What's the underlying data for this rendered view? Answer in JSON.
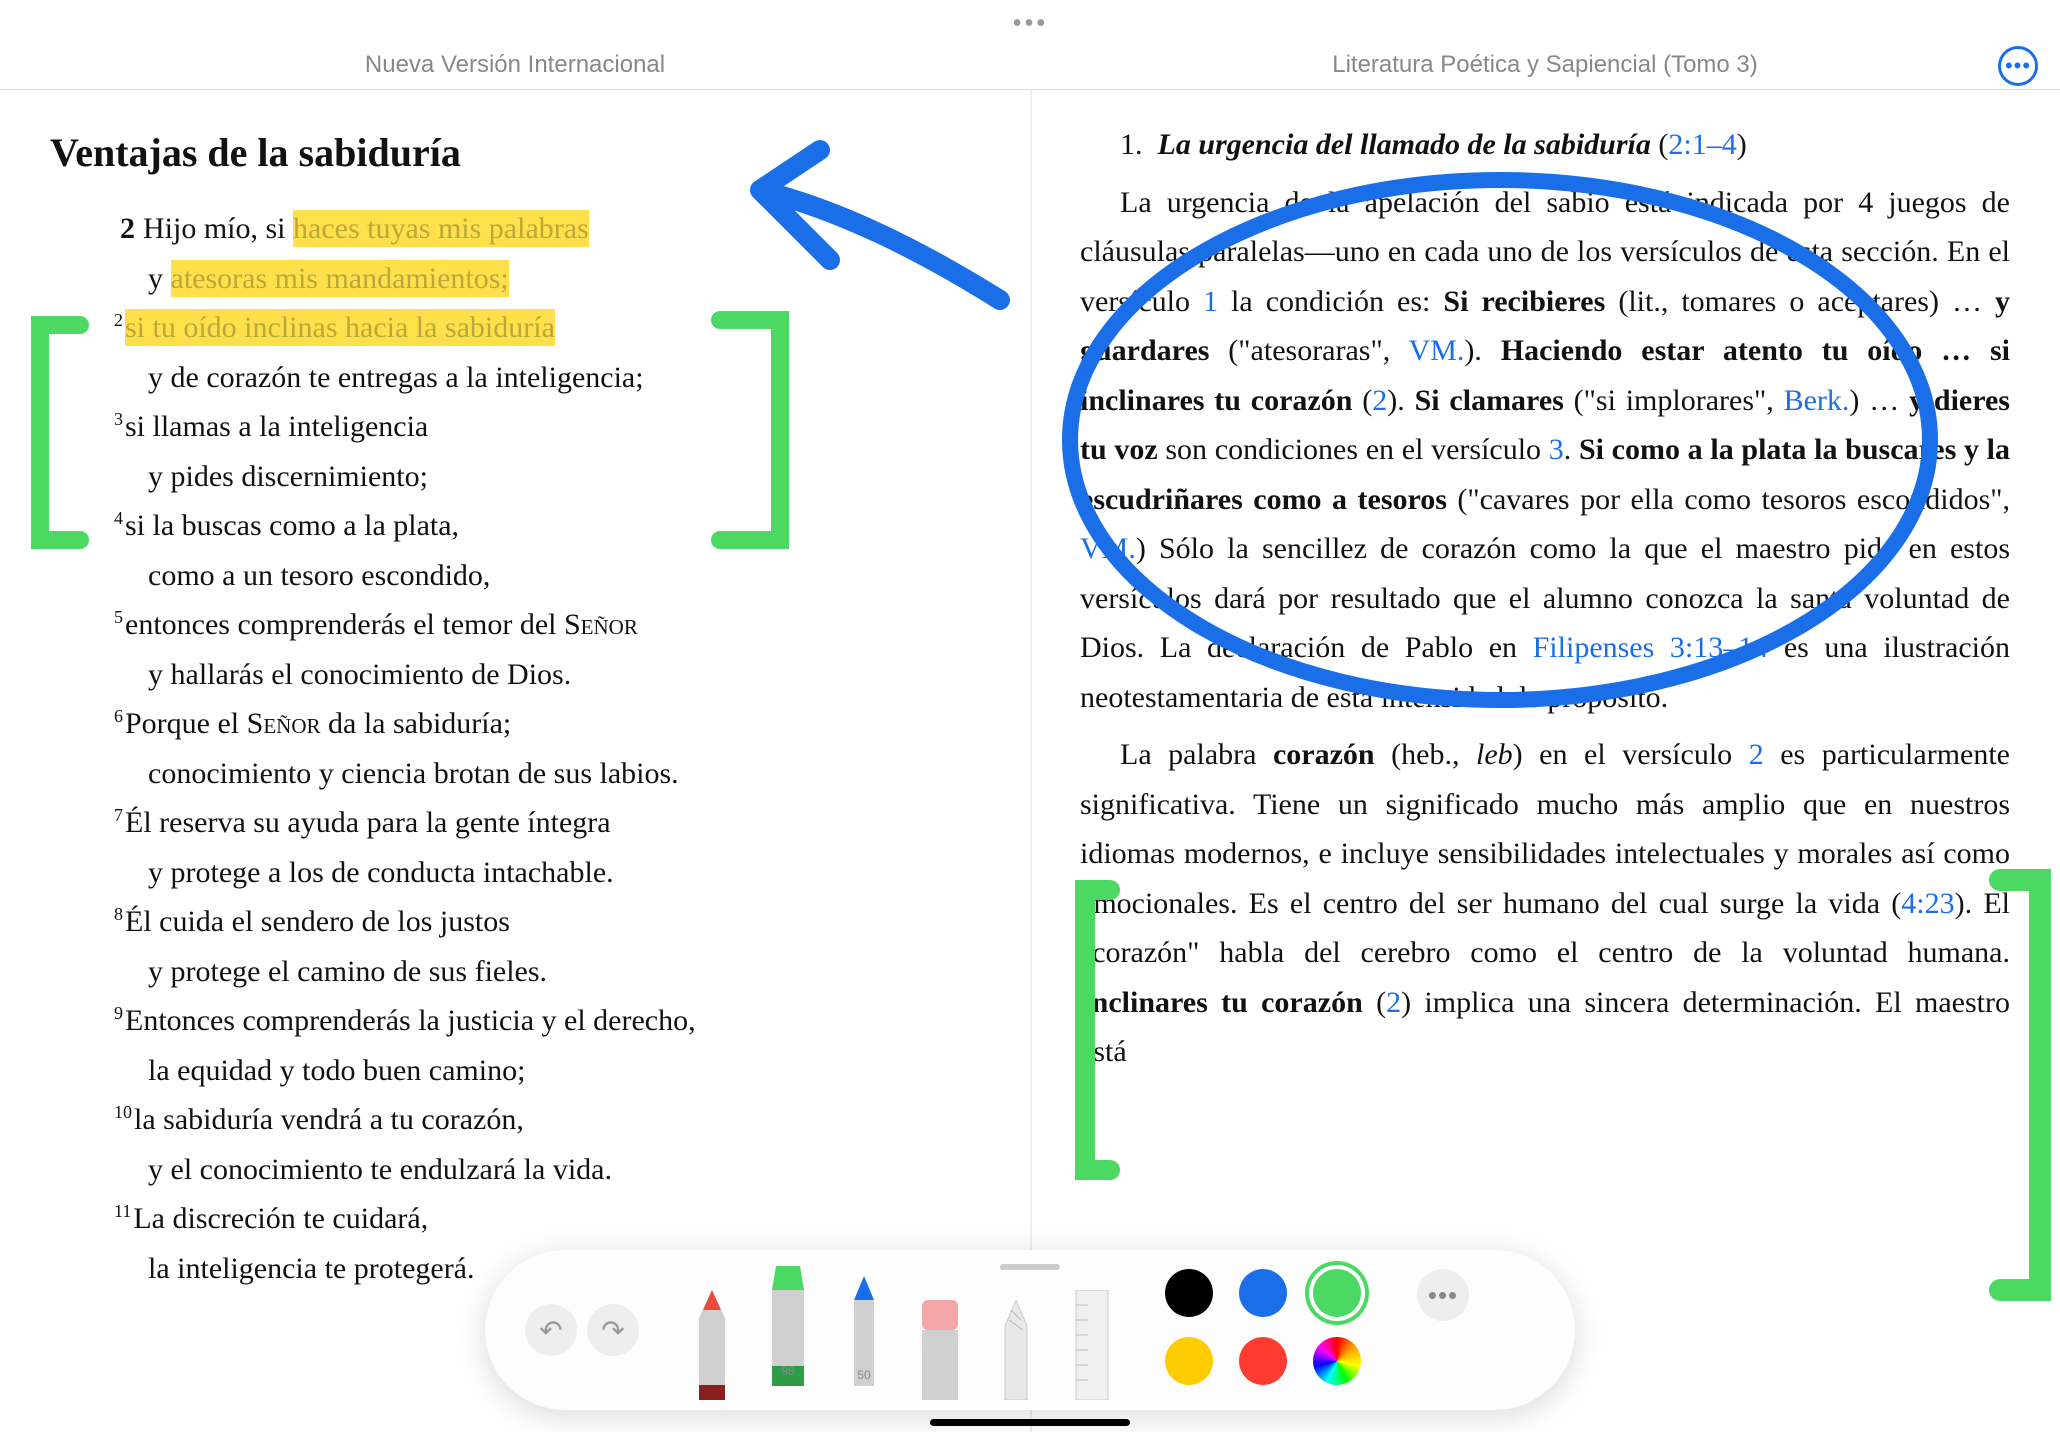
{
  "header": {
    "left_title": "Nueva Versión Internacional",
    "right_title": "Literatura Poética y Sapiencial (Tomo 3)"
  },
  "left": {
    "section_title": "Ventajas de la sabiduría",
    "v2_num": "2",
    "v2a_pre": "Hijo mío, si ",
    "v2a_hl": "haces tuyas mis palabras",
    "v2b_pre": "y ",
    "v2b_hl": "atesoras mis mandamientos;",
    "v2s_num": "2",
    "v2s_hl": "si tu oído inclinas hacia la sabiduría",
    "v2d": "y de corazón te entregas a la inteligencia;",
    "v3_num": "3",
    "v3a": "si llamas a la inteligencia",
    "v3b": "y pides discernimiento;",
    "v4_num": "4",
    "v4a": "si la buscas como a la plata,",
    "v4b": "como a un tesoro escondido,",
    "v5_num": "5",
    "v5a_pre": "entonces comprenderás el temor del ",
    "v5a_sc": "Señor",
    "v5b": "y hallarás el conocimiento de Dios.",
    "v6_num": "6",
    "v6a_pre": "Porque el ",
    "v6a_sc": "Señor",
    "v6a_post": " da la sabiduría;",
    "v6b": "conocimiento y ciencia brotan de sus labios.",
    "v7_num": "7",
    "v7a": "Él reserva su ayuda para la gente íntegra",
    "v7b": "y protege a los de conducta intachable.",
    "v8_num": "8",
    "v8a": "Él cuida el sendero de los justos",
    "v8b": "y protege el camino de sus fieles.",
    "v9_num": "9",
    "v9a": "Entonces comprenderás la justicia y el derecho,",
    "v9b": "la equidad y todo buen camino;",
    "v10_num": "10",
    "v10a": "la sabiduría vendrá a tu corazón,",
    "v10b": "y el conocimiento te endulzará la vida.",
    "v11_num": "11",
    "v11a": "La discreción te cuidará,",
    "v11b": "la inteligencia te protegerá."
  },
  "right": {
    "item_num": "1.",
    "item_title": "La urgencia del llamado de la sabiduría",
    "item_ref": "2:1–4",
    "p1_a": "La urgencia de la apelación del sabio está indicada por 4 juegos de cláusulas paralelas—uno en cada uno de los versículos de esta sección. En el versículo ",
    "p1_ref1": "1",
    "p1_b": " la condición es: ",
    "p1_bold1": "Si recibieres",
    "p1_c": " (lit., tomares o aceptares) … ",
    "p1_bold2": "y guardares",
    "p1_d": " (\"atesoraras\", ",
    "p1_ref2": "VM.",
    "p1_e": "). ",
    "p1_bold3": "Haciendo estar atento tu oído … si inclinares tu corazón",
    "p1_f": " (",
    "p1_ref3": "2",
    "p1_g": "). ",
    "p1_bold4": "Si clamares",
    "p1_h": " (\"si implorares\", ",
    "p1_ref4": "Berk.",
    "p1_i": ") … ",
    "p1_bold5": "y dieres tu voz",
    "p1_j": " son condiciones en el versículo ",
    "p1_ref5": "3",
    "p1_k": ". ",
    "p1_bold6": "Si como a la plata la buscares y la escudriñares como a tesoros",
    "p1_l": " (\"cavares por ella como tesoros escondidos\", ",
    "p1_ref6": "VM.",
    "p1_m": ") Sólo la sencillez de corazón como la que el maestro pide en estos versículos dará por resultado que el alumno conozca la santa voluntad de Dios. La declaración de Pablo en ",
    "p1_ref7": "Filipenses 3:13–14",
    "p1_n": " es una ilustración neotestamentaria de esta intensidad de propósito.",
    "p2_a": "La palabra ",
    "p2_bold1": "corazón",
    "p2_b": " (heb., ",
    "p2_ital1": "leb",
    "p2_c": ") en el versículo ",
    "p2_ref1": "2",
    "p2_d": " es particularmente significativa. Tiene un significado mucho más amplio que en nuestros idiomas modernos, e incluye sensibilidades intelectuales y morales así como emocionales. Es el centro del ser humano del cual surge la vida (",
    "p2_ref2": "4:23",
    "p2_e": "). El \"corazón\" habla del cerebro como el centro de la voluntad humana. ",
    "p2_bold2": "Inclinares tu corazón",
    "p2_f": " (",
    "p2_ref3": "2",
    "p2_g": ") implica una sincera determinación. El maestro está"
  },
  "toolbar": {
    "undo": "↶",
    "redo": "↷",
    "hl_label": "98",
    "pencil_label": "50",
    "colors": {
      "black": "#000000",
      "blue": "#1a6fe8",
      "green": "#4bd964",
      "yellow": "#ffcc00",
      "red": "#ff3b30"
    }
  }
}
